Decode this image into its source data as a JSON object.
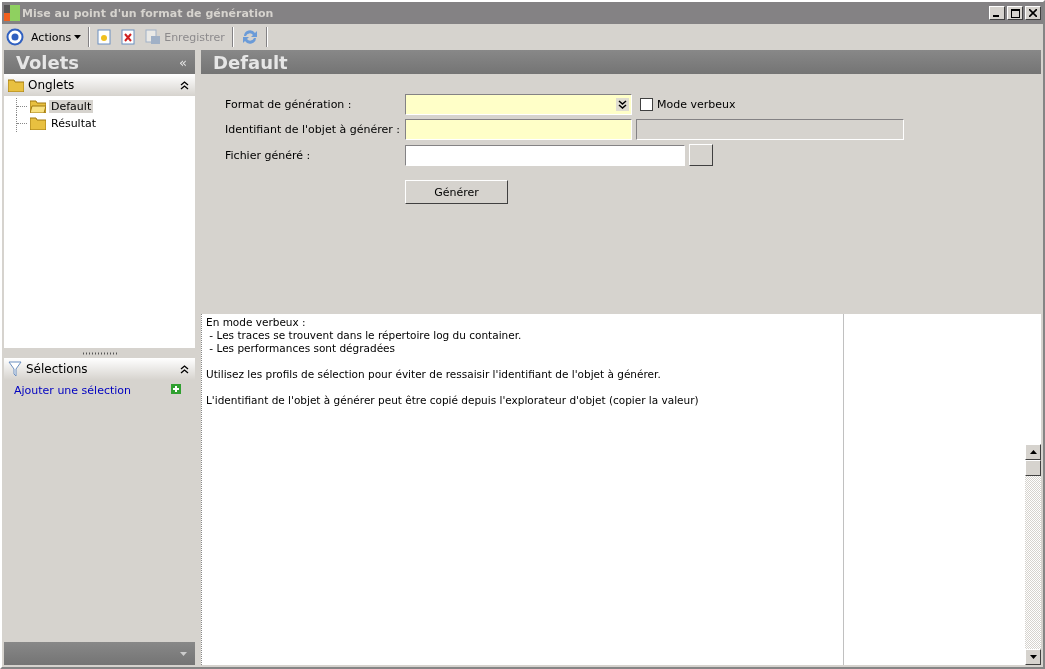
{
  "window": {
    "title": "Mise au point d'un format de génération"
  },
  "toolbar": [
    {
      "kind": "menu",
      "label": "Actions"
    },
    {
      "kind": "new"
    },
    {
      "kind": "delete"
    },
    {
      "kind": "save",
      "label": "Enregistrer",
      "disabled": true
    },
    {
      "kind": "refresh"
    }
  ],
  "sidebar": {
    "title": "Volets",
    "collapse": "«",
    "tabs_section": {
      "title": "Onglets",
      "expanded": true,
      "items": [
        {
          "label": "Default",
          "selected": true
        },
        {
          "label": "Résultat",
          "selected": false
        }
      ]
    },
    "selections_section": {
      "title": "Sélections",
      "expanded": true,
      "link": "Ajouter une sélection"
    }
  },
  "panel": {
    "title": "Default",
    "form": {
      "format_label": "Format de génération  :",
      "verbose": {
        "label": "Mode verbeux",
        "checked": false
      },
      "identifier_label": "Identifiant de l'objet à générer :",
      "file_label": "Fichier généré :",
      "generate_button": "Générer"
    },
    "help": [
      {
        "lines": [
          "En mode verbeux :",
          " - Les traces se trouvent dans le répertoire log du container.",
          " - Les performances sont dégradées"
        ]
      },
      {
        "lines": [
          "Utilisez les profils de sélection pour éviter de ressaisir l'identifiant de l'objet à générer."
        ]
      },
      {
        "lines": [
          "L'identifiant de l'objet à générer peut être copié depuis l'explorateur d'objet (copier la valeur)"
        ]
      }
    ]
  }
}
